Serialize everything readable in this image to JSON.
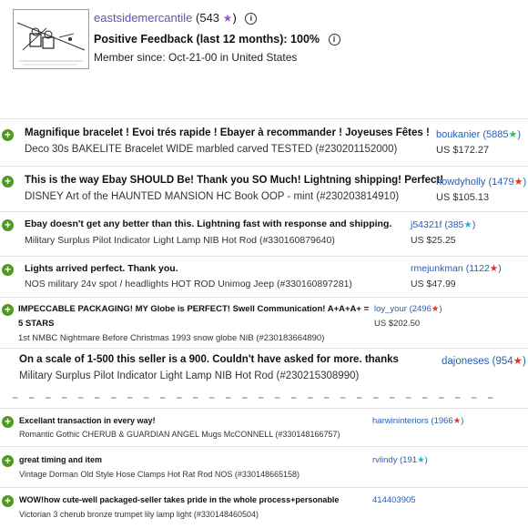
{
  "seller": {
    "name": "eastsidemercantile",
    "count": "(543",
    "count_close": ")",
    "positive_feedback": "Positive Feedback (last 12 months): 100%",
    "member_since": "Member since: Oct-21-00 in United States"
  },
  "icons": {
    "info": "info-icon",
    "plus": "plus-circle-icon",
    "star": "star-icon"
  },
  "colors": {
    "seller_name": "#6b4fa8",
    "link": "#2a5db0",
    "positive": "#4e9a1e",
    "star_green": "#2fbf71",
    "star_red": "#d9362b",
    "star_teal": "#2bb3c0",
    "star_purple": "#9b59d0"
  },
  "feedback": [
    {
      "comment": "Magnifique bracelet ! Evoi trés rapide ! Ebayer à recommander ! Joyeuses Fêtes !",
      "item": "Deco 30s BAKELITE Bracelet WIDE marbled carved TESTED (#230201152000)",
      "buyer": "boukanier",
      "count": "(5885",
      "star": "green",
      "price": "US $172.27"
    },
    {
      "comment": "This is the way Ebay SHOULD Be! Thank you SO Much! Lightning shipping! Perfect!",
      "item": "DISNEY Art of the HAUNTED MANSION HC Book OOP - mint (#230203814910)",
      "buyer": "howdyholly",
      "count": "(1479",
      "star": "red",
      "price": "US $105.13"
    },
    {
      "comment": "Ebay doesn't get any better than this. Lightning fast with response and shipping.",
      "item": "Military Surplus Pilot Indicator Light Lamp NIB Hot Rod (#330160879640)",
      "buyer": "j54321f",
      "count": "(385",
      "star": "teal",
      "price": "US $25.25"
    },
    {
      "comment": "Lights arrived perfect. Thank you.",
      "item": "NOS military 24v spot / headlights HOT ROD Unimog Jeep (#330160897281)",
      "buyer": "rmejunkman",
      "count": "(1122",
      "star": "red",
      "price": "US $47.99"
    },
    {
      "comment": "IMPECCABLE PACKAGING! MY Globe is PERFECT! Swell Communication! A+A+A+ =",
      "comment2": "5 STARS",
      "item": "1st NMBC Nightmare Before Christmas 1993 snow globe NIB (#230183664890)",
      "buyer": "loy_your",
      "count": "(2496",
      "star": "red",
      "price": "US $202.50"
    },
    {
      "comment": "On a scale of 1-500 this seller is a 900. Couldn't have asked for more. thanks",
      "item": "Military Surplus Pilot Indicator Light Lamp NIB Hot Rod (#230215308990)",
      "buyer": "dajoneses",
      "count": "(954",
      "star": "red"
    },
    {
      "comment": "Excellant transaction in every way!",
      "item": "Romantic Gothic CHERUB & GUARDIAN ANGEL Mugs McCONNELL (#330148166757)",
      "buyer": "harwininteriors",
      "count": "(1966",
      "star": "red"
    },
    {
      "comment": "great timing and item",
      "item": "Vintage Dorman Old Style Hose Clamps Hot Rat Rod NOS (#330148665158)",
      "buyer": "rvlindy",
      "count": "(191",
      "star": "teal"
    },
    {
      "comment": "WOW!how cute-well packaged-seller takes pride in the whole process+personable",
      "item": "Victorian 3 cherub bronze trumpet lily lamp light (#330148460504)",
      "buyer": "414403905"
    }
  ]
}
